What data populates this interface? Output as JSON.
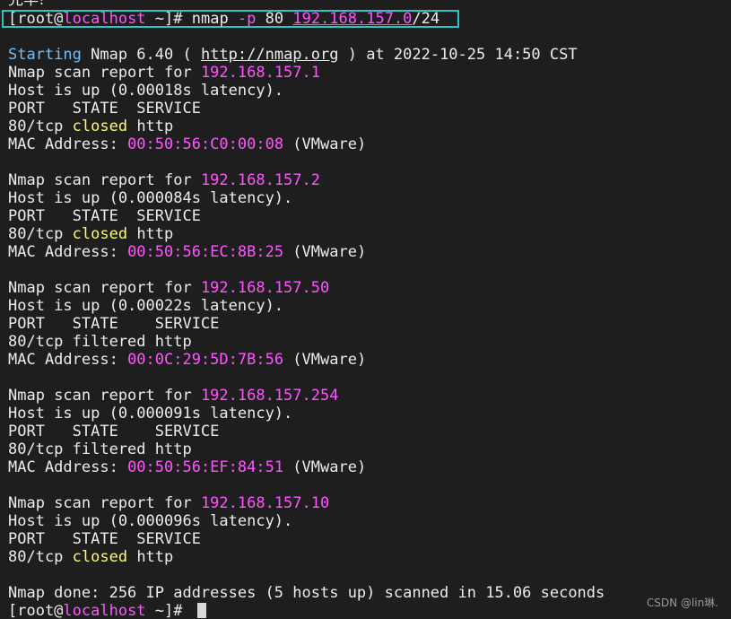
{
  "colors": {
    "background": "#1e1e1e",
    "text": "#ececec",
    "highlight_box": "#2ec4c4",
    "cyan": "#6fc0ff",
    "magenta": "#ff55ff",
    "yellow": "#ffff55",
    "cursor": "#d8d8d8"
  },
  "partial_top_text": "完毕!",
  "terminal_lines": [
    [
      {
        "t": "[root@",
        "c": "text"
      },
      {
        "t": "localhost",
        "c": "magenta"
      },
      {
        "t": " ~]# ",
        "c": "text"
      },
      {
        "t": "nmap ",
        "c": "text"
      },
      {
        "t": "-p",
        "c": "magenta"
      },
      {
        "t": " 80 ",
        "c": "text"
      },
      {
        "t": "192.168.157.0",
        "c": "magenta",
        "u": true
      },
      {
        "t": "/24",
        "c": "text"
      }
    ],
    [],
    [
      {
        "t": "Starting",
        "c": "cyan"
      },
      {
        "t": " Nmap 6.40 ( ",
        "c": "text"
      },
      {
        "t": "http://nmap.org",
        "c": "text",
        "u": true
      },
      {
        "t": " ) at 2022-10-25 14:50 CST",
        "c": "text"
      }
    ],
    [
      {
        "t": "Nmap scan report for ",
        "c": "text"
      },
      {
        "t": "192.168.157.1",
        "c": "magenta"
      }
    ],
    [
      {
        "t": "Host is up (0.00018s latency).",
        "c": "text"
      }
    ],
    [
      {
        "t": "PORT   STATE  SERVICE",
        "c": "text"
      }
    ],
    [
      {
        "t": "80/tcp ",
        "c": "text"
      },
      {
        "t": "closed",
        "c": "yellow"
      },
      {
        "t": " http",
        "c": "text"
      }
    ],
    [
      {
        "t": "MAC Address: ",
        "c": "text"
      },
      {
        "t": "00:50:56:C0:00:08",
        "c": "magenta"
      },
      {
        "t": " (VMware)",
        "c": "text"
      }
    ],
    [],
    [
      {
        "t": "Nmap scan report for ",
        "c": "text"
      },
      {
        "t": "192.168.157.2",
        "c": "magenta"
      }
    ],
    [
      {
        "t": "Host is up (0.000084s latency).",
        "c": "text"
      }
    ],
    [
      {
        "t": "PORT   STATE  SERVICE",
        "c": "text"
      }
    ],
    [
      {
        "t": "80/tcp ",
        "c": "text"
      },
      {
        "t": "closed",
        "c": "yellow"
      },
      {
        "t": " http",
        "c": "text"
      }
    ],
    [
      {
        "t": "MAC Address: ",
        "c": "text"
      },
      {
        "t": "00:50:56:EC:8B:25",
        "c": "magenta"
      },
      {
        "t": " (VMware)",
        "c": "text"
      }
    ],
    [],
    [
      {
        "t": "Nmap scan report for ",
        "c": "text"
      },
      {
        "t": "192.168.157.50",
        "c": "magenta"
      }
    ],
    [
      {
        "t": "Host is up (0.00022s latency).",
        "c": "text"
      }
    ],
    [
      {
        "t": "PORT   STATE    SERVICE",
        "c": "text"
      }
    ],
    [
      {
        "t": "80/tcp filtered http",
        "c": "text"
      }
    ],
    [
      {
        "t": "MAC Address: ",
        "c": "text"
      },
      {
        "t": "00:0C:29:5D:7B:56",
        "c": "magenta"
      },
      {
        "t": " (VMware)",
        "c": "text"
      }
    ],
    [],
    [
      {
        "t": "Nmap scan report for ",
        "c": "text"
      },
      {
        "t": "192.168.157.254",
        "c": "magenta"
      }
    ],
    [
      {
        "t": "Host is up (0.000091s latency).",
        "c": "text"
      }
    ],
    [
      {
        "t": "PORT   STATE    SERVICE",
        "c": "text"
      }
    ],
    [
      {
        "t": "80/tcp filtered http",
        "c": "text"
      }
    ],
    [
      {
        "t": "MAC Address: ",
        "c": "text"
      },
      {
        "t": "00:50:56:EF:84:51",
        "c": "magenta"
      },
      {
        "t": " (VMware)",
        "c": "text"
      }
    ],
    [],
    [
      {
        "t": "Nmap scan report for ",
        "c": "text"
      },
      {
        "t": "192.168.157.10",
        "c": "magenta"
      }
    ],
    [
      {
        "t": "Host is up (0.000096s latency).",
        "c": "text"
      }
    ],
    [
      {
        "t": "PORT   STATE  SERVICE",
        "c": "text"
      }
    ],
    [
      {
        "t": "80/tcp ",
        "c": "text"
      },
      {
        "t": "closed",
        "c": "yellow"
      },
      {
        "t": " http",
        "c": "text"
      }
    ],
    [],
    [
      {
        "t": "Nmap done: 256 IP addresses (5 hosts up) scanned in 15.06 seconds",
        "c": "text"
      }
    ],
    [
      {
        "t": "[root@",
        "c": "text"
      },
      {
        "t": "localhost",
        "c": "magenta"
      },
      {
        "t": " ~]# ",
        "c": "text"
      }
    ]
  ],
  "watermark": "CSDN @lin琳."
}
